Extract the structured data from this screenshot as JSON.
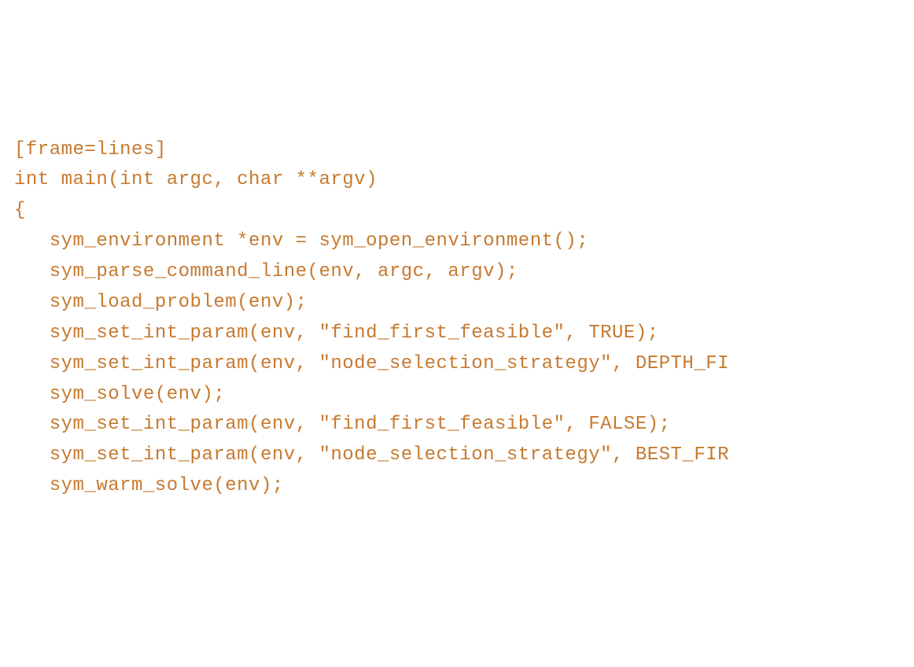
{
  "code": {
    "lines": [
      "[frame=lines]",
      "int main(int argc, char **argv)",
      "{",
      "   sym_environment *env = sym_open_environment();",
      "   sym_parse_command_line(env, argc, argv);",
      "   sym_load_problem(env);",
      "   sym_set_int_param(env, \"find_first_feasible\", TRUE);",
      "   sym_set_int_param(env, \"node_selection_strategy\", DEPTH_FI",
      "   sym_solve(env);",
      "   sym_set_int_param(env, \"find_first_feasible\", FALSE);",
      "   sym_set_int_param(env, \"node_selection_strategy\", BEST_FIR",
      "   sym_warm_solve(env);"
    ]
  }
}
